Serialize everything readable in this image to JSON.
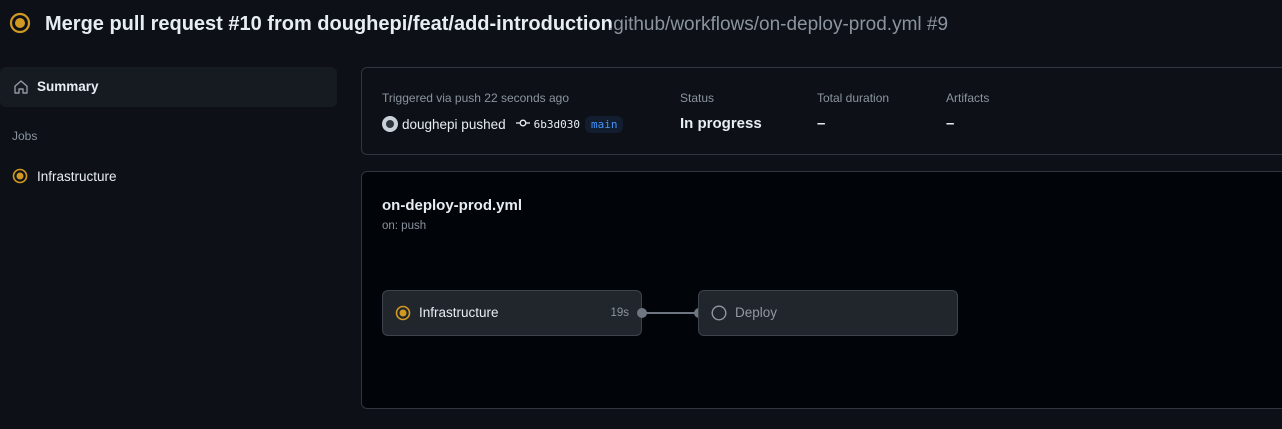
{
  "header": {
    "title": "Merge pull request #10 from doughepi/feat/add-introduction",
    "subtitle": ".github/workflows/on-deploy-prod.yml #9",
    "status_icon": "in-progress-icon"
  },
  "sidebar": {
    "summary_label": "Summary",
    "summary_icon": "home-icon",
    "jobs_heading": "Jobs",
    "jobs": [
      {
        "label": "Infrastructure",
        "status": "in-progress"
      }
    ]
  },
  "summary": {
    "triggered_text": "Triggered via push 22 seconds ago",
    "actor": "doughepi pushed",
    "commit_sha": "6b3d030",
    "branch": "main",
    "status_label": "Status",
    "status_value": "In progress",
    "duration_label": "Total duration",
    "duration_value": "–",
    "artifacts_label": "Artifacts",
    "artifacts_value": "–"
  },
  "workflow": {
    "file": "on-deploy-prod.yml",
    "trigger": "on: push",
    "jobs": [
      {
        "name": "Infrastructure",
        "duration": "19s",
        "status": "in-progress"
      },
      {
        "name": "Deploy",
        "duration": "",
        "status": "queued"
      }
    ]
  },
  "colors": {
    "in_progress": "#d29922",
    "background": "#0d1117",
    "card_border": "#30363d",
    "branch_text": "#4493f8"
  }
}
